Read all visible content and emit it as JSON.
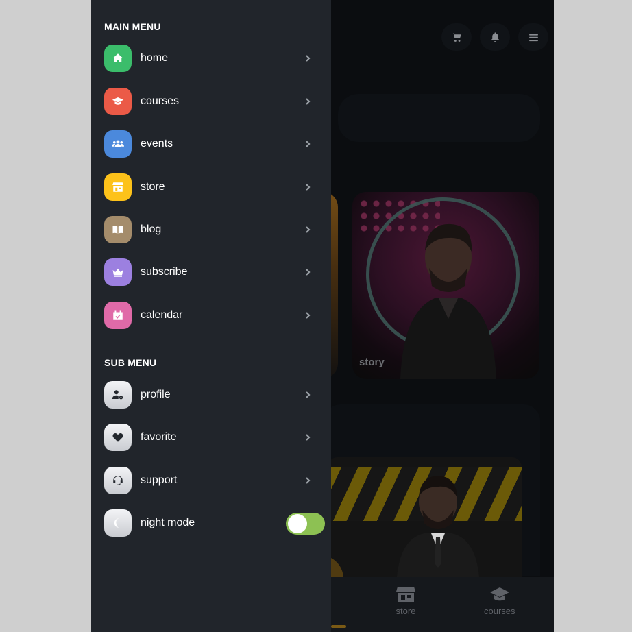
{
  "sidebar": {
    "main_menu_title": "MAIN MENU",
    "sub_menu_title": "SUB MENU",
    "main_items": [
      {
        "label": "home",
        "icon": "home-icon",
        "color": "#3bbd6b"
      },
      {
        "label": "courses",
        "icon": "graduation-cap-icon",
        "color": "#eb5a47"
      },
      {
        "label": "events",
        "icon": "users-icon",
        "color": "#4b89dc"
      },
      {
        "label": "store",
        "icon": "store-icon",
        "color": "#fdc21a"
      },
      {
        "label": "blog",
        "icon": "book-icon",
        "color": "#a48c6b"
      },
      {
        "label": "subscribe",
        "icon": "crown-icon",
        "color": "#9c80e0"
      },
      {
        "label": "calendar",
        "icon": "calendar-check-icon",
        "color": "#e06aa8"
      }
    ],
    "sub_items": [
      {
        "label": "profile",
        "icon": "user-cog-icon"
      },
      {
        "label": "favorite",
        "icon": "heart-icon"
      },
      {
        "label": "support",
        "icon": "headset-icon"
      }
    ],
    "night_mode": {
      "label": "night mode",
      "icon": "moon-icon",
      "enabled": true,
      "toggle_color": "#8dc153"
    }
  },
  "background": {
    "story_label": "story",
    "bottom_nav": [
      {
        "label": "store",
        "icon": "store-icon"
      },
      {
        "label": "courses",
        "icon": "graduation-cap-icon"
      }
    ],
    "top_icons": [
      "cart-icon",
      "bell-icon",
      "menu-icon"
    ]
  }
}
